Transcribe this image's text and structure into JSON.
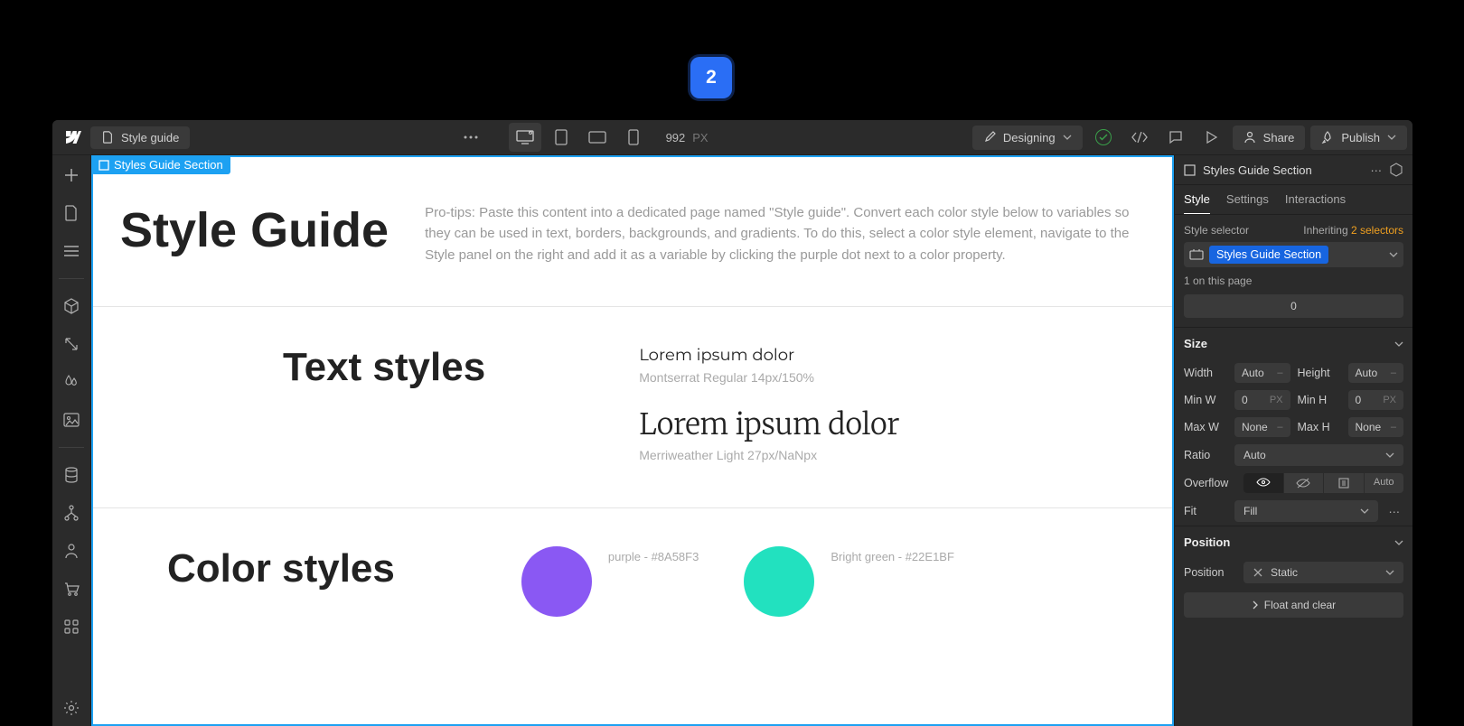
{
  "badge": {
    "number": "2"
  },
  "topbar": {
    "page_name": "Style guide",
    "viewport_value": "992",
    "viewport_unit": "PX",
    "mode_label": "Designing",
    "share_label": "Share",
    "publish_label": "Publish"
  },
  "canvas": {
    "selection_label": "Styles Guide Section",
    "hero_title": "Style Guide",
    "hero_tip": "Pro-tips: Paste this content into a dedicated page named \"Style guide\". Convert each color style below to variables so they can be used in text, borders, backgrounds, and gradients. To do this, select a color style element, navigate to the Style panel on the right and add it as a variable by clicking the purple dot next to a color property.",
    "text_styles_heading": "Text styles",
    "sample1_title": "Lorem ipsum dolor",
    "sample1_meta": "Montserrat Regular 14px/150%",
    "sample2_title": "Lorem ipsum dolor",
    "sample2_meta": "Merriweather Light 27px/NaNpx",
    "color_styles_heading": "Color styles",
    "swatches": [
      {
        "label": "purple - #8A58F3",
        "hex": "#8A58F3"
      },
      {
        "label": "Bright green - #22E1BF",
        "hex": "#22E1BF"
      }
    ]
  },
  "panel": {
    "element_name": "Styles Guide Section",
    "tabs": {
      "style": "Style",
      "settings": "Settings",
      "interactions": "Interactions"
    },
    "selector_label": "Style selector",
    "inheriting_prefix": "Inheriting ",
    "inheriting_count": "2 selectors",
    "class_tag": "Styles Guide Section",
    "on_page": "1 on this page",
    "indicator_value": "0",
    "size": {
      "heading": "Size",
      "width_label": "Width",
      "width_value": "Auto",
      "height_label": "Height",
      "height_value": "Auto",
      "minw_label": "Min W",
      "minw_value": "0",
      "minw_unit": "PX",
      "minh_label": "Min H",
      "minh_value": "0",
      "minh_unit": "PX",
      "maxw_label": "Max W",
      "maxw_value": "None",
      "maxh_label": "Max H",
      "maxh_value": "None",
      "ratio_label": "Ratio",
      "ratio_value": "Auto",
      "overflow_label": "Overflow",
      "overflow_auto": "Auto",
      "fit_label": "Fit",
      "fit_value": "Fill"
    },
    "position": {
      "heading": "Position",
      "label": "Position",
      "value": "Static",
      "float_label": "Float and clear"
    }
  }
}
